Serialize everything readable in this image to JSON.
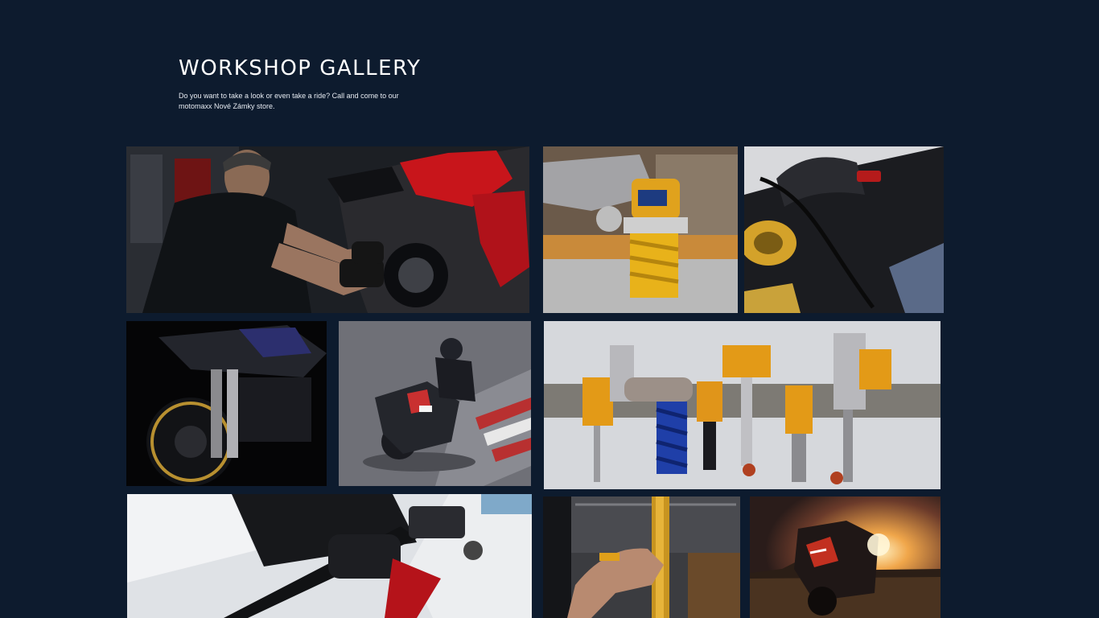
{
  "gallery": {
    "title": "WORKSHOP GALLERY",
    "subtitle": "Do you want to take a look or even take a ride? Call and come to our motomaxx Nové Zámky store."
  },
  "photos": [
    {
      "subject": "mechanic working on red motorcycle",
      "alt": "Mechanic servicing a red sport motorcycle"
    },
    {
      "subject": "gold suspension shock on workbench",
      "alt": "Gold rear shock absorber mounted on a swingarm"
    },
    {
      "subject": "motorcycle handlebar and cockpit closeup",
      "alt": "Motorcycle handlebar, cables and fork top"
    },
    {
      "subject": "black motorcycle front wheel with gold forks",
      "alt": "Black motorcycle front end with gold forks"
    },
    {
      "subject": "rider leaning on race track",
      "alt": "Rider cornering on a race track"
    },
    {
      "subject": "shock absorbers hanging on wall rack",
      "alt": "Row of shock absorbers on a wall rack"
    },
    {
      "subject": "white motorcycle handlebar with red levers",
      "alt": "White motorcycle handlebar with red brake lever"
    },
    {
      "subject": "mechanic assembling gold fork",
      "alt": "Mechanic assembling a gold front fork"
    },
    {
      "subject": "motorcycle at sunset in field",
      "alt": "Adventure motorcycle in a field at sunset"
    }
  ],
  "colors": {
    "background": "#0d1b2e",
    "title": "#ffffff",
    "subtitle": "#e6ebf2"
  }
}
